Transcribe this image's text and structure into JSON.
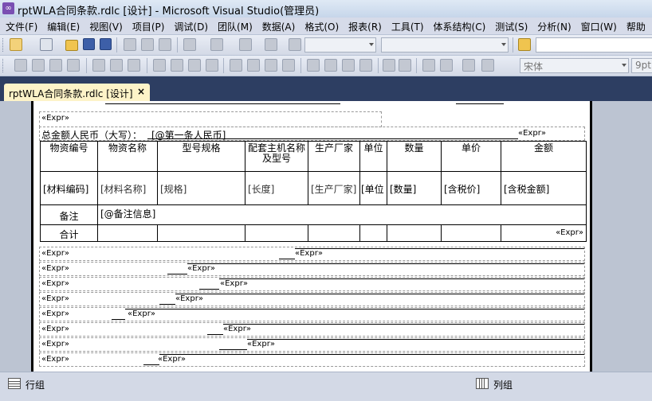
{
  "window": {
    "title": "rptWLA合同条款.rdlc [设计] - Microsoft Visual Studio(管理员)"
  },
  "menu": [
    "文件(F)",
    "编辑(E)",
    "视图(V)",
    "项目(P)",
    "调试(D)",
    "团队(M)",
    "数据(A)",
    "格式(O)",
    "报表(R)",
    "工具(T)",
    "体系结构(C)",
    "测试(S)",
    "分析(N)",
    "窗口(W)",
    "帮助"
  ],
  "toolbar2": {
    "font_name": "宋体",
    "font_size": "9pt"
  },
  "tab": {
    "label": "rptWLA合同条款.rdlc [设计]",
    "close": "×"
  },
  "report": {
    "top_expr": "«Expr»",
    "amount_label": "总金额人民币（大写）：",
    "amount_value": "[@第一条人民币]",
    "amount_expr": "«Expr»",
    "table": {
      "headers": [
        "物资编号",
        "物资名称",
        "型号规格",
        "配套主机名称及型号",
        "生产厂家",
        "单位",
        "数量",
        "单价",
        "金额"
      ],
      "values": [
        "[材料编码]",
        "[材料名称]",
        "[规格]",
        "[长度]",
        "[生产厂家]",
        "[单位",
        "[数量]",
        "[含税价]",
        "[含税金额]"
      ],
      "remark_label": "备注",
      "remark_value": "[@备注信息]",
      "total_label": "合计",
      "total_expr": "«Expr»"
    },
    "rows": [
      {
        "left": "«Expr»",
        "right": "«Expr»"
      },
      {
        "left": "«Expr»",
        "right": "«Expr»"
      },
      {
        "left": "«Expr»",
        "right": "«Expr»"
      },
      {
        "left": "«Expr»",
        "right": "«Expr»"
      },
      {
        "left": "«Expr»",
        "right": "«Expr»"
      },
      {
        "left": "«Expr»",
        "right": "«Expr»"
      },
      {
        "left": "«Expr»",
        "right": "«Expr»"
      },
      {
        "left": "«Expr»",
        "right": "«Expr»"
      }
    ]
  },
  "statusbar": {
    "row_groups": "行组",
    "column_groups": "列组"
  }
}
